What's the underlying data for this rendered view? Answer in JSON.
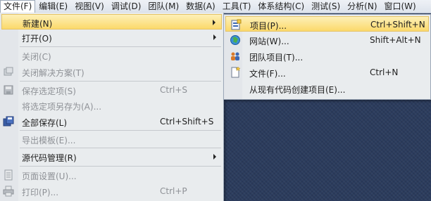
{
  "menubar": {
    "items": [
      "文件(F)",
      "编辑(E)",
      "视图(V)",
      "调试(D)",
      "团队(M)",
      "数据(A)",
      "工具(T)",
      "体系结构(C)",
      "测试(S)",
      "分析(N)",
      "窗口(W)"
    ]
  },
  "file_menu": {
    "new": {
      "label": "新建(N)",
      "icon": "none"
    },
    "open": {
      "label": "打开(O)",
      "icon": "none"
    },
    "close": {
      "label": "关闭(C)",
      "icon": "none"
    },
    "close_solution": {
      "label": "关闭解决方案(T)",
      "icon": "solution-icon"
    },
    "save_selected": {
      "label": "保存选定项(S)",
      "shortcut": "Ctrl+S",
      "icon": "save-icon"
    },
    "save_as": {
      "label": "将选定项另存为(A)..."
    },
    "save_all": {
      "label": "全部保存(L)",
      "shortcut": "Ctrl+Shift+S",
      "icon": "save-all-icon"
    },
    "export_template": {
      "label": "导出模板(E)..."
    },
    "source_control": {
      "label": "源代码管理(R)"
    },
    "page_setup": {
      "label": "页面设置(U)...",
      "icon": "page-setup-icon"
    },
    "print": {
      "label": "打印(P)...",
      "shortcut": "Ctrl+P",
      "icon": "print-icon"
    }
  },
  "new_submenu": {
    "project": {
      "label": "项目(P)...",
      "shortcut": "Ctrl+Shift+N",
      "icon": "project-icon"
    },
    "website": {
      "label": "网站(W)...",
      "shortcut": "Shift+Alt+N",
      "icon": "globe-icon"
    },
    "team_project": {
      "label": "团队项目(T)...",
      "icon": "team-project-icon"
    },
    "file": {
      "label": "文件(F)...",
      "shortcut": "Ctrl+N",
      "icon": "new-file-icon"
    },
    "from_existing": {
      "label": "从现有代码创建项目(E)..."
    }
  },
  "colors": {
    "highlight": "#fbd96b",
    "menu_bg": "#e9ecee",
    "workspace": "#2b3c5d"
  }
}
